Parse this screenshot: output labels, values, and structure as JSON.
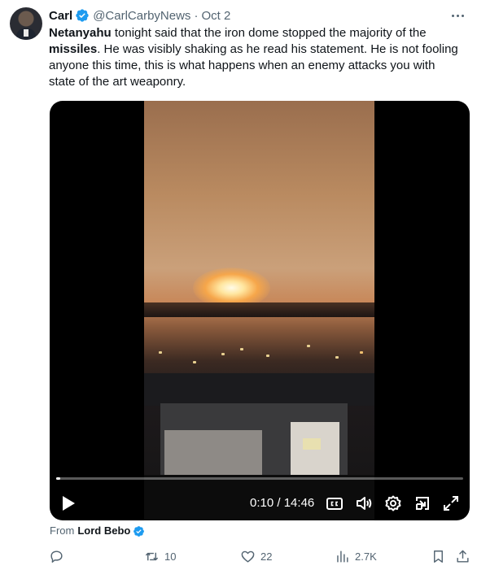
{
  "post": {
    "author_name": "Carl",
    "handle": "@CarlCarbyNews",
    "separator": "·",
    "date": "Oct 2",
    "text_bold_1": "Netanyahu",
    "text_part_1": " tonight said that the iron dome stopped the majority of the ",
    "text_bold_2": "missiles",
    "text_part_2": ". He was visibly shaking as he read his statement. He is not fooling anyone this time, this is what happens when an enemy attacks you with state of the art weaponry."
  },
  "video": {
    "current_time": "0:10",
    "duration": "14:46",
    "time_separator": " / ",
    "progress": 0.011
  },
  "source": {
    "prefix": "From",
    "name": "Lord Bebo"
  },
  "actions": {
    "reply_count": "",
    "repost_count": "10",
    "like_count": "22",
    "views_count": "2.7K"
  },
  "icons": {
    "verified": "verified-badge-icon",
    "more": "more-icon",
    "play": "play-icon",
    "captions": "captions-icon",
    "volume": "volume-icon",
    "settings": "gear-icon",
    "pip": "picture-in-picture-icon",
    "fullscreen": "fullscreen-icon",
    "reply": "reply-icon",
    "repost": "repost-icon",
    "like": "heart-icon",
    "views": "views-icon",
    "bookmark": "bookmark-icon",
    "share": "share-icon"
  },
  "colors": {
    "verified_blue": "#1d9bf0",
    "text_primary": "#0f1419",
    "text_secondary": "#536471"
  }
}
